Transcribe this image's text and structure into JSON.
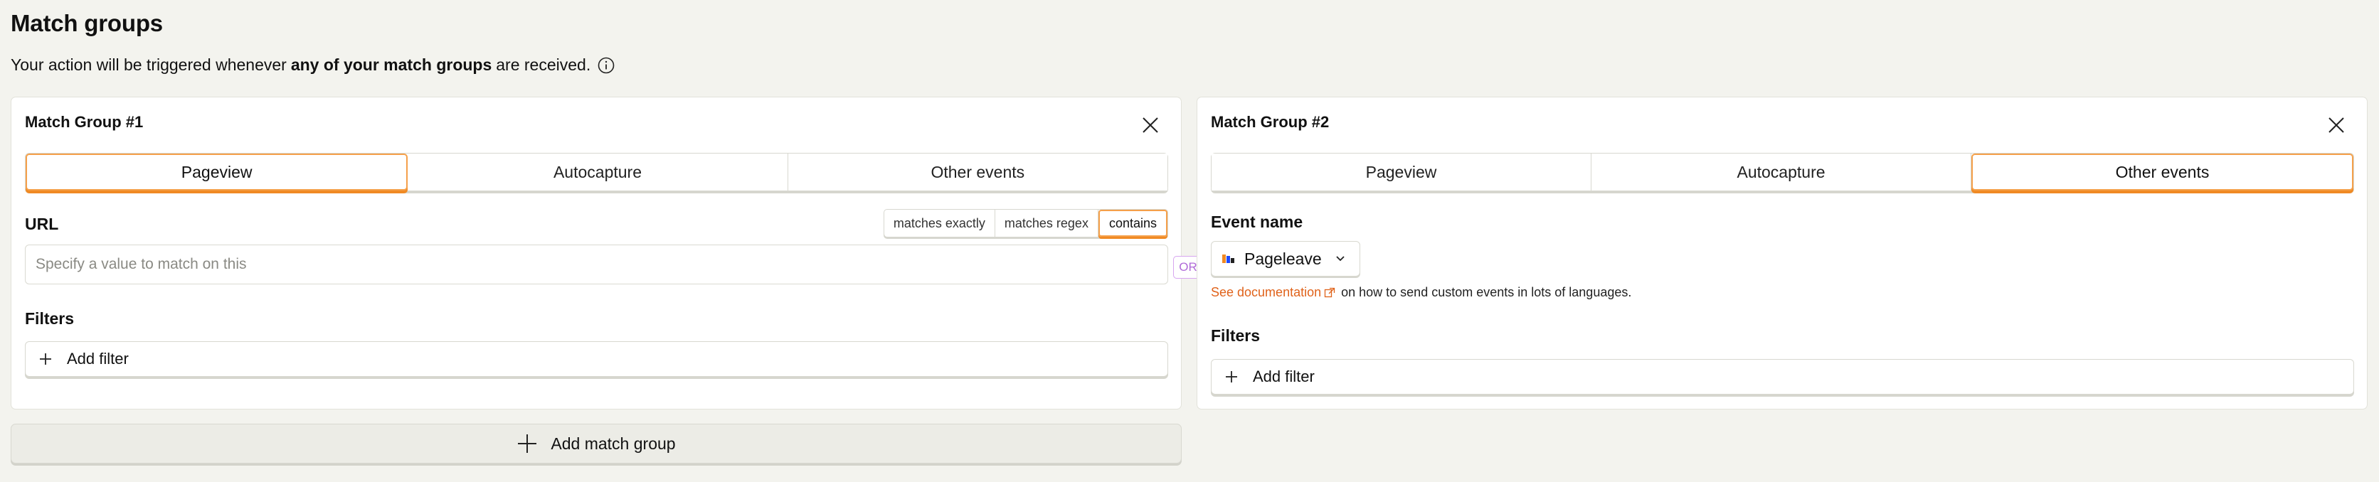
{
  "page": {
    "title": "Match groups",
    "description_prefix": "Your action will be triggered whenever",
    "description_bold": "any of your match groups",
    "description_suffix": "are received."
  },
  "groups": [
    {
      "title": "Match Group #1",
      "tabs": [
        "Pageview",
        "Autocapture",
        "Other events"
      ],
      "active_tab": "Pageview",
      "url_label": "URL",
      "match_types": [
        "matches exactly",
        "matches regex",
        "contains"
      ],
      "active_match_type": "contains",
      "url_placeholder": "Specify a value to match on this",
      "filters_label": "Filters",
      "add_filter_label": "Add filter"
    },
    {
      "title": "Match Group #2",
      "tabs": [
        "Pageview",
        "Autocapture",
        "Other events"
      ],
      "active_tab": "Other events",
      "event_name_label": "Event name",
      "event_value": "Pageleave",
      "doc_link": "See documentation",
      "doc_suffix": "on how to send custom events in lots of languages.",
      "filters_label": "Filters",
      "add_filter_label": "Add filter"
    }
  ],
  "or_label": "OR",
  "add_match_group_label": "Add match group",
  "colors": {
    "accent": "#f5a04a",
    "accent_shadow": "#f08a24",
    "link": "#e0621a",
    "or_badge": "#b06ad8",
    "background": "#f3f3ee"
  },
  "icons": [
    "info-icon",
    "close-icon",
    "plus-icon",
    "chevron-down-icon",
    "external-link-icon",
    "pageleave-icon"
  ]
}
